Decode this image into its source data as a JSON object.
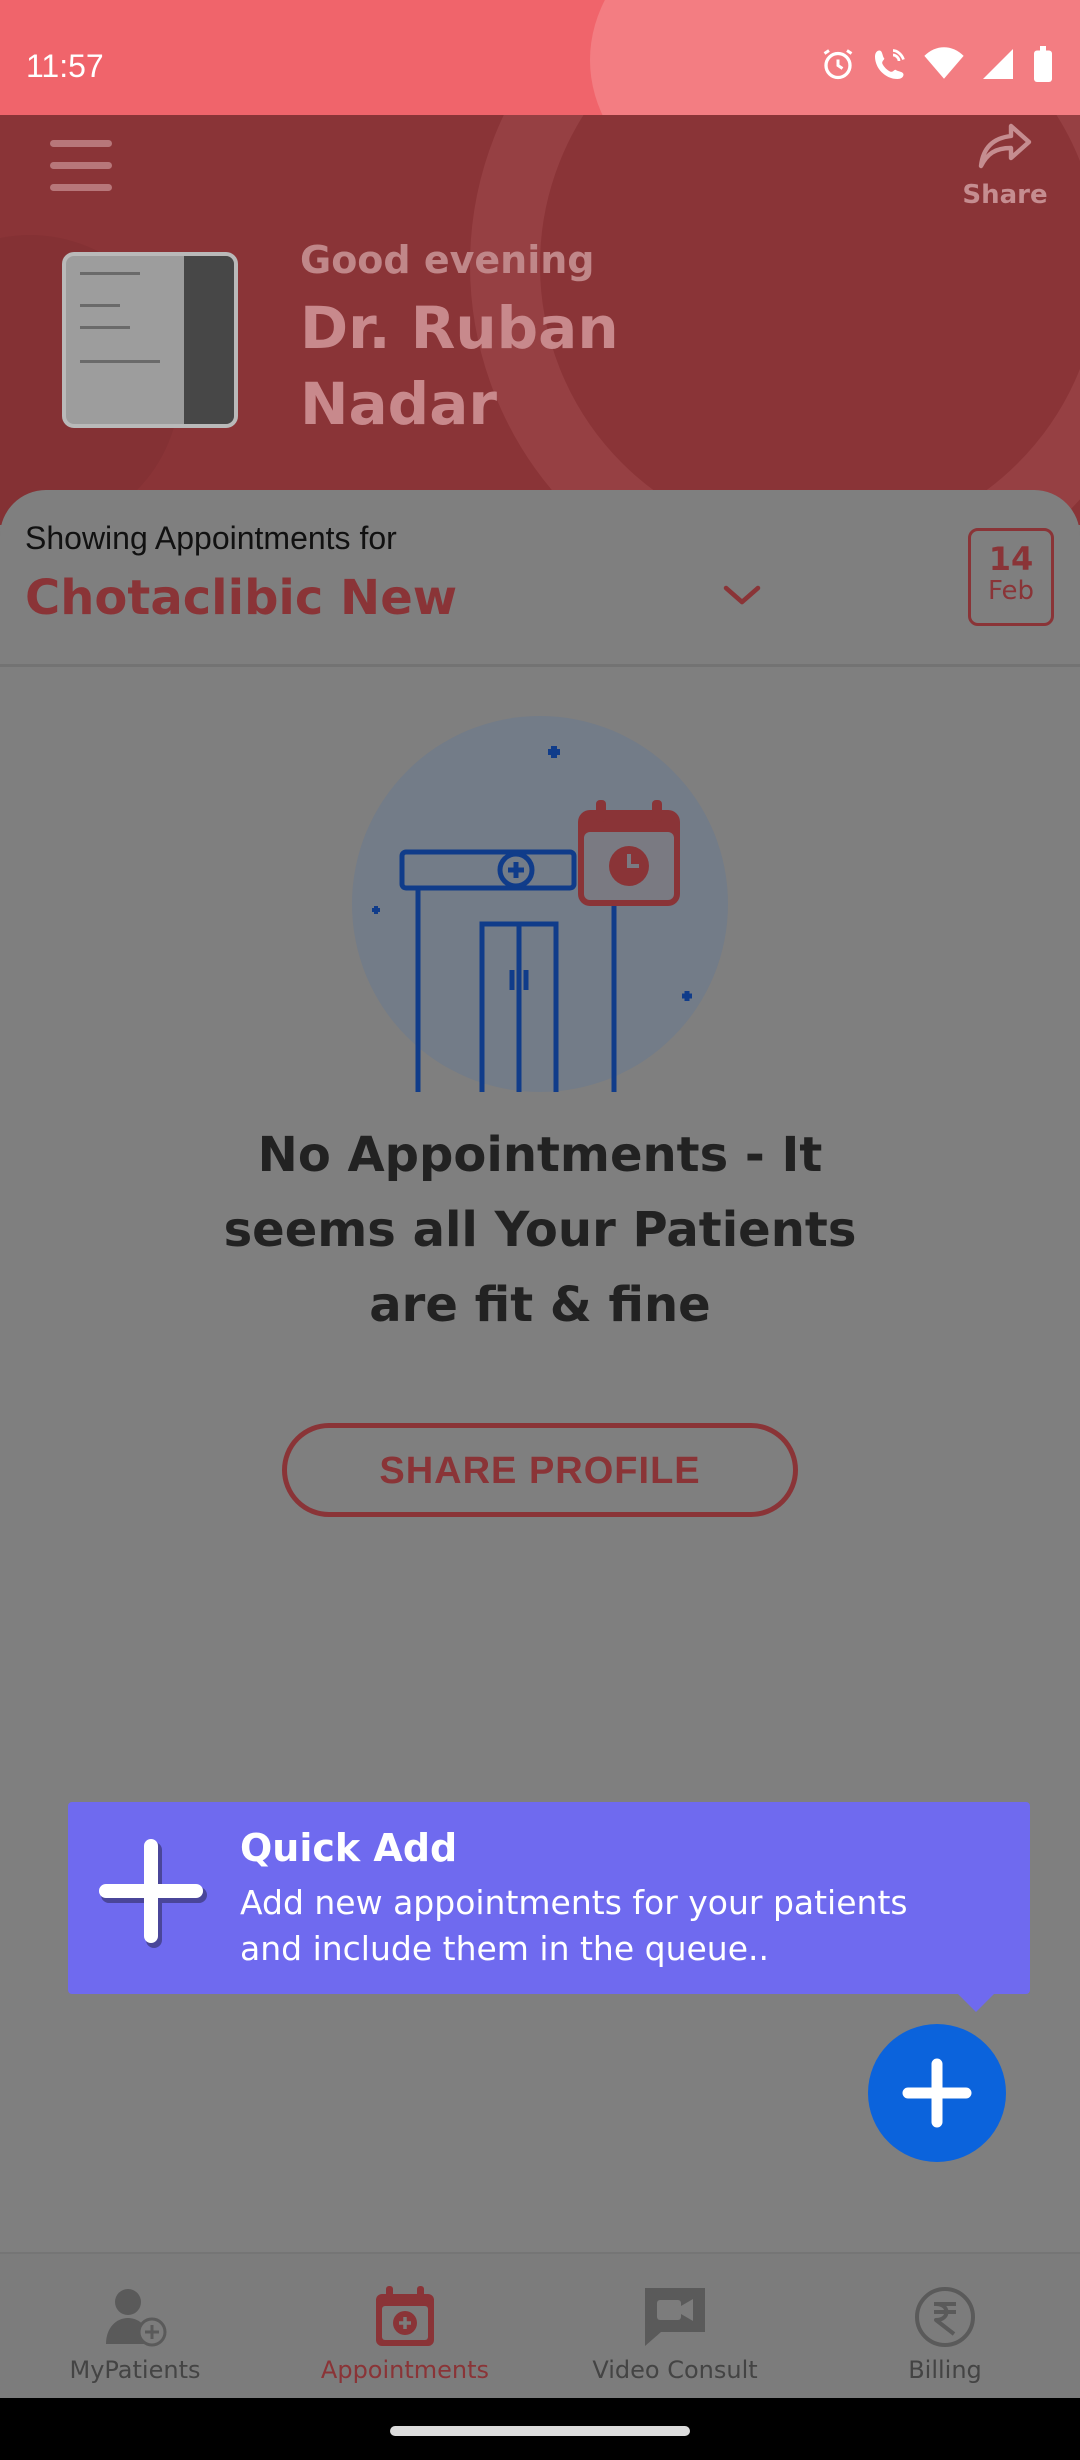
{
  "status_bar": {
    "time": "11:57"
  },
  "header": {
    "share_label": "Share",
    "greeting": "Good evening",
    "doctor_name": "Dr. Ruban Nadar"
  },
  "clinic": {
    "showing_label": "Showing Appointments for",
    "name": "Chotaclibic New",
    "date_day": "14",
    "date_month": "Feb"
  },
  "empty_state": {
    "message": "No Appointments - It seems all Your Patients are fit & fine",
    "share_profile_label": "SHARE PROFILE"
  },
  "tooltip": {
    "title": "Quick Add",
    "body": "Add new appointments for your patients and include them in the queue.."
  },
  "bottom_nav": {
    "items": [
      {
        "label": "MyPatients",
        "icon": "patient-add-icon",
        "active": false
      },
      {
        "label": "Appointments",
        "icon": "calendar-plus-icon",
        "active": true
      },
      {
        "label": "Video Consult",
        "icon": "video-chat-icon",
        "active": false
      },
      {
        "label": "Billing",
        "icon": "rupee-icon",
        "active": false
      }
    ]
  },
  "colors": {
    "brand_red": "#f0646b",
    "header_dim": "#8a3437",
    "tooltip": "#6f6aef",
    "fab": "#0b63dc"
  }
}
